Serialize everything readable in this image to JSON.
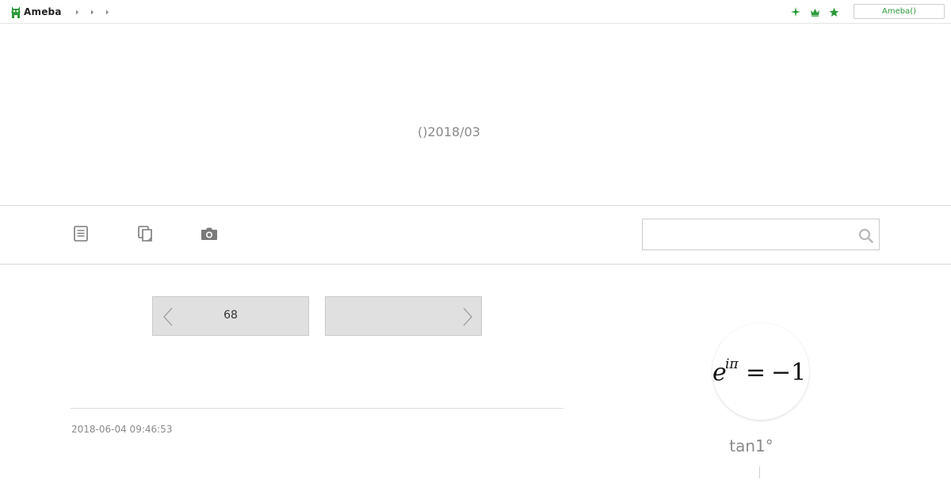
{
  "topbar": {
    "logo_text": "Ameba",
    "login_label": "Ameba()",
    "brand_color": "#2d9a3a",
    "icons": [
      "sparkle-icon",
      "crown-icon",
      "star-icon"
    ]
  },
  "header": {
    "title": "()2018/03"
  },
  "nav": {
    "icons": [
      "entry-list-icon",
      "archive-icon",
      "camera-icon"
    ],
    "search_placeholder": "",
    "search_value": ""
  },
  "pager": {
    "prev_label": "68",
    "next_label": ""
  },
  "post": {
    "date": "2018-06-04 09:46:53"
  },
  "profile": {
    "name": "tan1°",
    "avatar_formula": "e^{iπ} = −1"
  }
}
